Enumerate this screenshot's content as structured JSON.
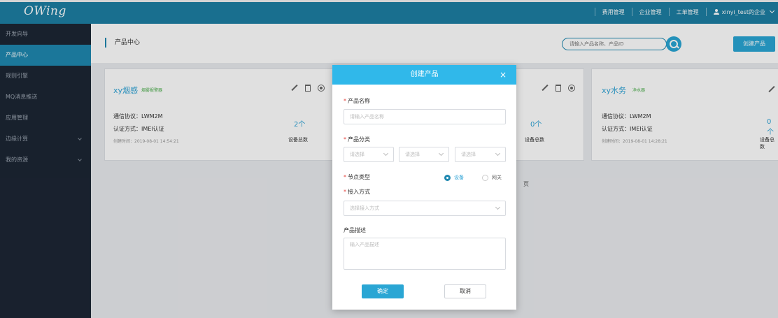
{
  "app": {
    "logo": "OWing"
  },
  "topnav": {
    "items": [
      "费用管理",
      "企业管理",
      "工单管理"
    ],
    "user": "xinyi_test的企业"
  },
  "sidebar": {
    "items": [
      {
        "label": "开发向导"
      },
      {
        "label": "产品中心"
      },
      {
        "label": "规则引擎"
      },
      {
        "label": "MQ消息推送"
      },
      {
        "label": "应用管理"
      },
      {
        "label": "边缘计算"
      },
      {
        "label": "我的资源"
      }
    ]
  },
  "header": {
    "title": "产品中心",
    "search_placeholder": "请输入产品名称、产品ID",
    "create_label": "创建产品"
  },
  "cards": [
    {
      "name": "xy烟感",
      "tag": "烟雾报警器",
      "protocol": "通信协议：LWM2M",
      "auth": "认证方式：IMEI认证",
      "created": "创建时间：2019-08-01 14:54:21",
      "count": "2个",
      "count_label": "设备总数"
    },
    {
      "count": "0个",
      "count_label": "设备总数"
    },
    {
      "name": "xy水务",
      "tag": "净水器",
      "protocol": "通信协议：LWM2M",
      "auth": "认证方式：IMEI认证",
      "created": "创建时间：2019-08-01 14:28:21",
      "count": "0个",
      "count_label": "设备总数"
    }
  ],
  "pagination": {
    "tail": "页"
  },
  "modal": {
    "title": "创建产品",
    "close_glyph": "×",
    "required_mark": "*",
    "name_label": "产品名称",
    "name_placeholder": "请输入产品名称",
    "category_label": "产品分类",
    "category_placeholder": "请选择",
    "node_type_label": "节点类型",
    "node_options": [
      "设备",
      "网关"
    ],
    "access_label": "接入方式",
    "access_placeholder": "选择接入方式",
    "desc_label": "产品描述",
    "desc_placeholder": "输入产品描述",
    "ok_label": "确定",
    "cancel_label": "取消"
  }
}
